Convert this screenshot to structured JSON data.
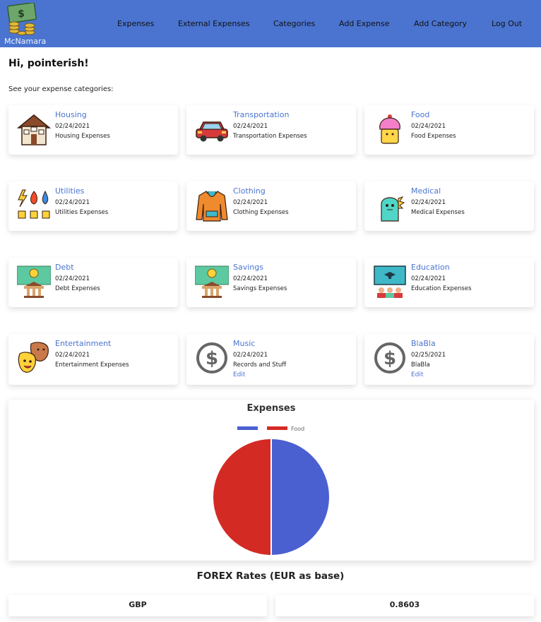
{
  "brand": {
    "name": "McNamara",
    "icon": "money-stack-icon",
    "accent": "#4a74d0"
  },
  "nav": {
    "items": [
      {
        "label": "Expenses"
      },
      {
        "label": "External Expenses"
      },
      {
        "label": "Categories"
      },
      {
        "label": "Add Expense"
      },
      {
        "label": "Add Category"
      },
      {
        "label": "Log Out"
      }
    ]
  },
  "greeting": "Hi, pointerish!",
  "subtitle": "See your expense categories:",
  "categories": [
    {
      "title": "Housing",
      "date": "02/24/2021",
      "desc": "Housing Expenses",
      "icon": "house-icon"
    },
    {
      "title": "Transportation",
      "date": "02/24/2021",
      "desc": "Transportation Expenses",
      "icon": "car-icon"
    },
    {
      "title": "Food",
      "date": "02/24/2021",
      "desc": "Food Expenses",
      "icon": "cupcake-icon"
    },
    {
      "title": "Utilities",
      "date": "02/24/2021",
      "desc": "Utilities Expenses",
      "icon": "utilities-icon"
    },
    {
      "title": "Clothing",
      "date": "02/24/2021",
      "desc": "Clothing Expenses",
      "icon": "hoodie-icon"
    },
    {
      "title": "Medical",
      "date": "02/24/2021",
      "desc": "Medical Expenses",
      "icon": "germ-icon"
    },
    {
      "title": "Debt",
      "date": "02/24/2021",
      "desc": "Debt Expenses",
      "icon": "bank-money-icon"
    },
    {
      "title": "Savings",
      "date": "02/24/2021",
      "desc": "Savings Expenses",
      "icon": "bank-money-icon"
    },
    {
      "title": "Education",
      "date": "02/24/2021",
      "desc": "Education Expenses",
      "icon": "classroom-icon"
    },
    {
      "title": "Entertainment",
      "date": "02/24/2021",
      "desc": "Entertainment Expenses",
      "icon": "theater-masks-icon"
    },
    {
      "title": "Music",
      "date": "02/24/2021",
      "desc": "Records and Stuff",
      "icon": "dollar-circle-icon",
      "edit": "Edit"
    },
    {
      "title": "BlaBla",
      "date": "02/25/2021",
      "desc": "BlaBla",
      "icon": "dollar-circle-icon",
      "edit": "Edit"
    }
  ],
  "chart_data": {
    "type": "pie",
    "title": "Expenses",
    "series": [
      {
        "name": "",
        "value": 50,
        "color": "#4a5fd0"
      },
      {
        "name": "Food",
        "value": 50,
        "color": "#d42a24"
      }
    ],
    "legend": "top"
  },
  "forex": {
    "title": "FOREX Rates (EUR as base)",
    "currency": "GBP",
    "rate": "0.8603"
  }
}
